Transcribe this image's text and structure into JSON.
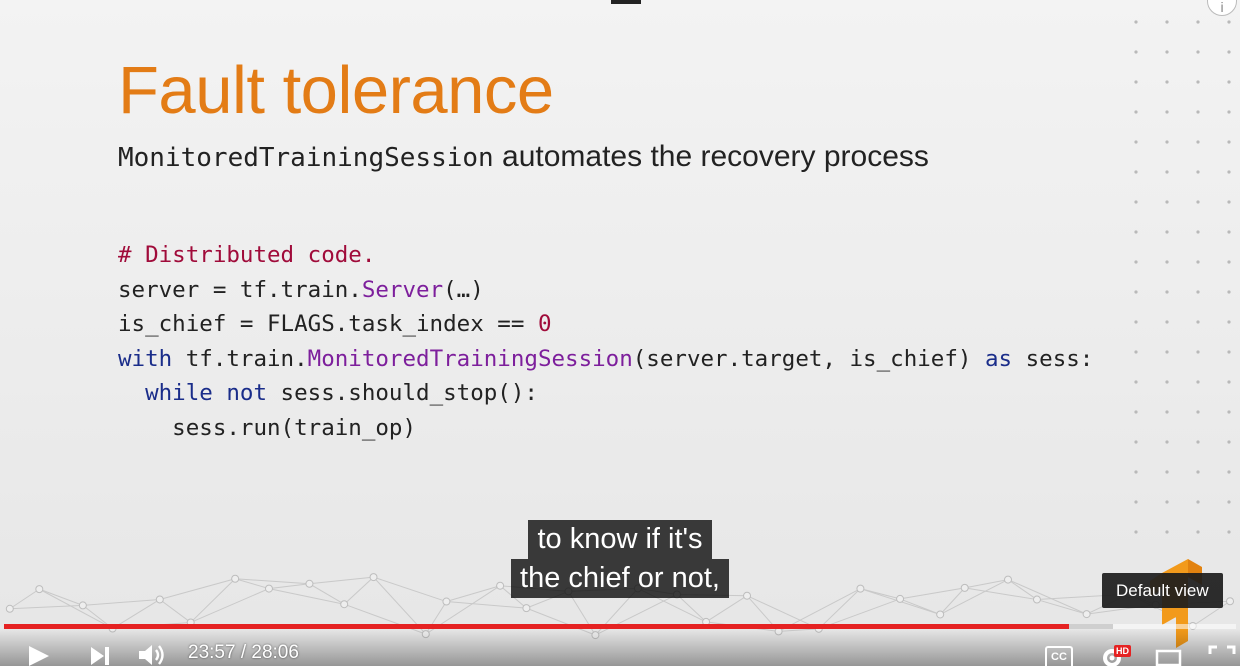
{
  "slide": {
    "title": "Fault tolerance",
    "subtitle_code": "MonitoredTrainingSession",
    "subtitle_text": " automates the recovery process",
    "code": {
      "line1": "# Distributed code.",
      "line2_a": "server = tf.train.",
      "line2_call": "Server",
      "line2_b": "(…)",
      "line3_a": "is_chief = FLAGS.task_index == ",
      "line3_num": "0",
      "line4_kw1": "with",
      "line4_a": " tf.train.",
      "line4_call": "MonitoredTrainingSession",
      "line4_b": "(server.target, is_chief) ",
      "line4_kw2": "as",
      "line4_c": " sess:",
      "line5_indent": "  ",
      "line5_kw1": "while",
      "line5_space": " ",
      "line5_kw2": "not",
      "line5_a": " sess.should_stop():",
      "line6": "    sess.run(train_op)"
    }
  },
  "captions": {
    "line1": "to know if it's",
    "line2": "the chief or not,"
  },
  "tooltip": {
    "text": "Default view"
  },
  "player": {
    "current_time": "23:57",
    "separator": " / ",
    "duration": "28:06",
    "played_fraction": 0.8646,
    "buffered_fraction": 0.9,
    "cc_label": "CC",
    "hd_badge": "HD",
    "accent_color": "#e52222",
    "icons": [
      "play-icon",
      "next-icon",
      "volume-icon",
      "captions-icon",
      "settings-icon",
      "theater-mode-icon",
      "fullscreen-icon"
    ]
  }
}
